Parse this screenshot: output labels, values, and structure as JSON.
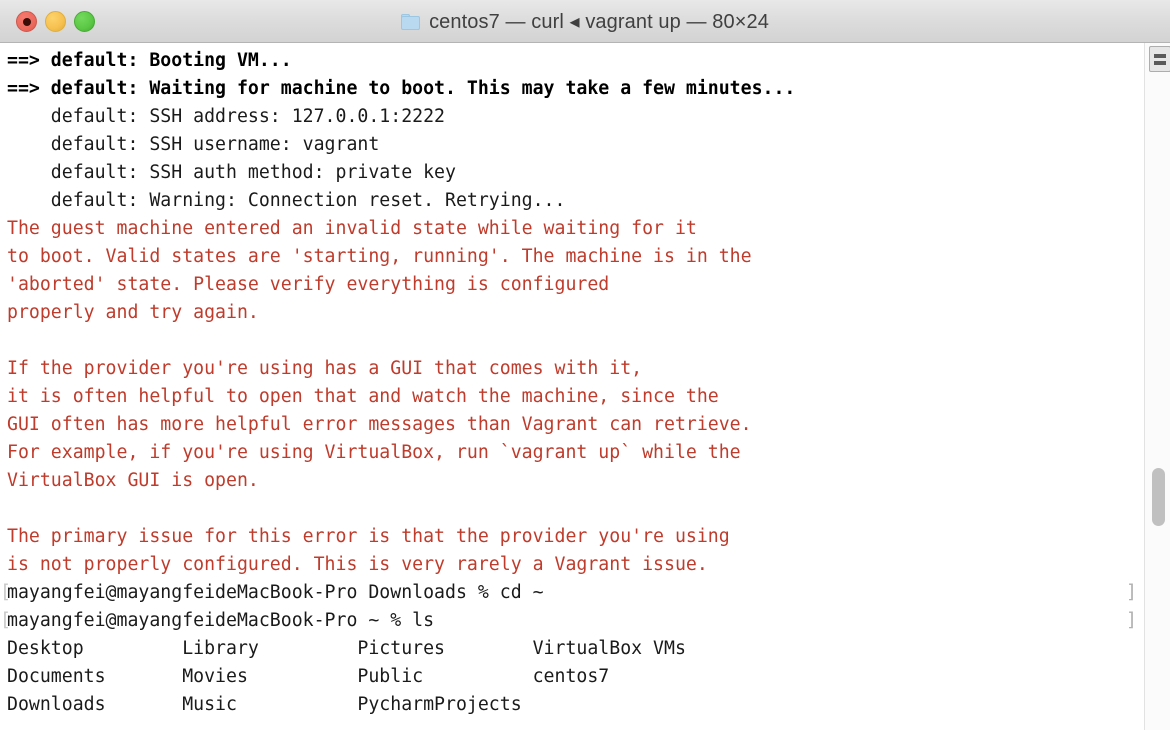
{
  "window": {
    "title": "centos7 — curl ◂ vagrant up — 80×24",
    "folder_icon": "folder-icon",
    "controls": {
      "close": "close-button",
      "minimize": "minimize-button",
      "maximize": "maximize-button"
    }
  },
  "scrollbar": {
    "marks_button_label": "marks-menu-button"
  },
  "terminal": {
    "colors": {
      "foreground": "#1a1a1a",
      "error": "#bf3b2b",
      "background": "#ffffff",
      "prompt_mark": "#c8c8c8"
    },
    "lines": [
      {
        "text": "==> default: Booting VM...",
        "style": "bold"
      },
      {
        "text": "==> default: Waiting for machine to boot. This may take a few minutes...",
        "style": "bold"
      },
      {
        "text": "    default: SSH address: 127.0.0.1:2222",
        "style": "normal"
      },
      {
        "text": "    default: SSH username: vagrant",
        "style": "normal"
      },
      {
        "text": "    default: SSH auth method: private key",
        "style": "normal"
      },
      {
        "text": "    default: Warning: Connection reset. Retrying...",
        "style": "normal"
      },
      {
        "text": "The guest machine entered an invalid state while waiting for it",
        "style": "err"
      },
      {
        "text": "to boot. Valid states are 'starting, running'. The machine is in the",
        "style": "err"
      },
      {
        "text": "'aborted' state. Please verify everything is configured",
        "style": "err"
      },
      {
        "text": "properly and try again.",
        "style": "err"
      },
      {
        "text": "",
        "style": "blank"
      },
      {
        "text": "If the provider you're using has a GUI that comes with it,",
        "style": "err"
      },
      {
        "text": "it is often helpful to open that and watch the machine, since the",
        "style": "err"
      },
      {
        "text": "GUI often has more helpful error messages than Vagrant can retrieve.",
        "style": "err"
      },
      {
        "text": "For example, if you're using VirtualBox, run `vagrant up` while the",
        "style": "err"
      },
      {
        "text": "VirtualBox GUI is open.",
        "style": "err"
      },
      {
        "text": "",
        "style": "blank"
      },
      {
        "text": "The primary issue for this error is that the provider you're using",
        "style": "err"
      },
      {
        "text": "is not properly configured. This is very rarely a Vagrant issue.",
        "style": "err"
      },
      {
        "text": "mayangfei@mayangfeideMacBook-Pro Downloads % cd ~",
        "style": "prompt"
      },
      {
        "text": "mayangfei@mayangfeideMacBook-Pro ~ % ls",
        "style": "prompt"
      },
      {
        "text": "Desktop         Library         Pictures        VirtualBox VMs",
        "style": "normal"
      },
      {
        "text": "Documents       Movies          Public          centos7",
        "style": "normal"
      },
      {
        "text": "Downloads       Music           PycharmProjects",
        "style": "normal"
      }
    ]
  }
}
